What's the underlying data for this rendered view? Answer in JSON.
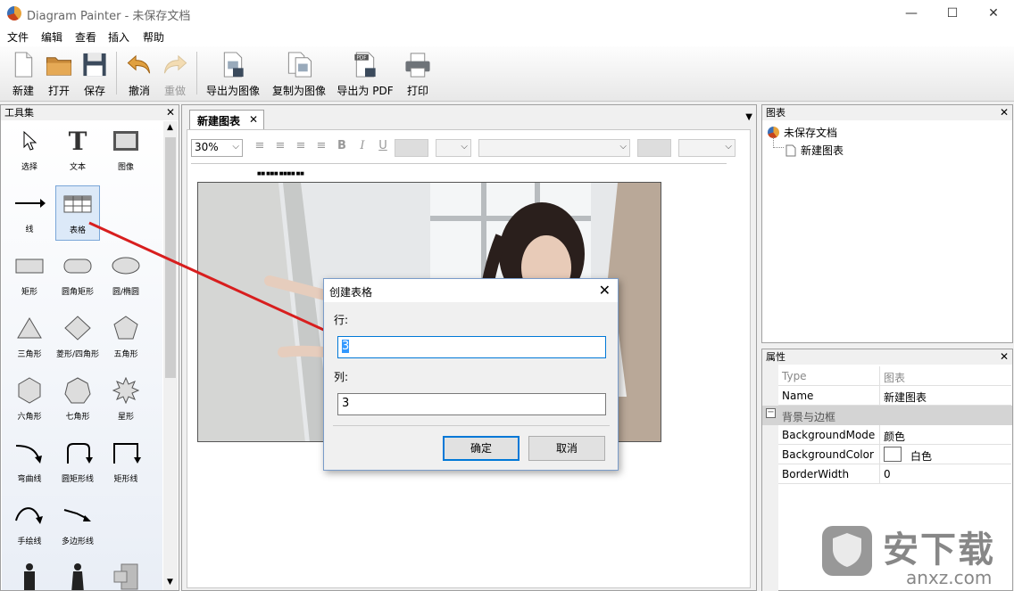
{
  "window": {
    "app_name": "Diagram Painter",
    "title": "Diagram Painter - 未保存文档",
    "min": "—",
    "max": "☐",
    "close": "✕"
  },
  "menu": [
    "文件",
    "编辑",
    "查看",
    "插入",
    "帮助"
  ],
  "toolbar": {
    "new": "新建",
    "open": "打开",
    "save": "保存",
    "undo": "撤消",
    "redo": "重做",
    "export_image": "导出为图像",
    "copy_image": "复制为图像",
    "export_pdf": "导出为 PDF",
    "print": "打印",
    "pdf_badge": "PDF"
  },
  "toolbox": {
    "title": "工具集",
    "tools": [
      "选择",
      "文本",
      "图像",
      "线",
      "表格",
      "矩形",
      "圆角矩形",
      "圆/椭圆",
      "三角形",
      "菱形/四角形",
      "五角形",
      "六角形",
      "七角形",
      "星形",
      "弯曲线",
      "圆矩形线",
      "矩形线",
      "手绘线",
      "多边形线"
    ]
  },
  "document": {
    "tab": "新建图表",
    "zoom": "30%",
    "format_buttons": {
      "bold": "B",
      "italic": "I",
      "underline": "U"
    },
    "tiny_label": "■■ ■■■ ■■■■ ■■"
  },
  "charts_pane": {
    "title": "图表",
    "root": "未保存文档",
    "child": "新建图表"
  },
  "props_pane": {
    "title": "属性",
    "rows": [
      {
        "key": "Type",
        "value": "图表"
      },
      {
        "key": "Name",
        "value": "新建图表"
      }
    ],
    "group": "背景与边框",
    "group_rows": [
      {
        "key": "BackgroundMode",
        "value": "颜色"
      },
      {
        "key": "BackgroundColor",
        "value": "白色"
      },
      {
        "key": "BorderWidth",
        "value": "0"
      }
    ]
  },
  "dialog": {
    "title": "创建表格",
    "rows_label": "行:",
    "rows_value": "3",
    "cols_label": "列:",
    "cols_value": "3",
    "ok": "确定",
    "cancel": "取消"
  },
  "watermark": {
    "text": "安下载",
    "url": "anxz.com"
  },
  "colors": {
    "arrow": "#d81e1e",
    "accent": "#0078d7",
    "selection": "#3399ff"
  }
}
